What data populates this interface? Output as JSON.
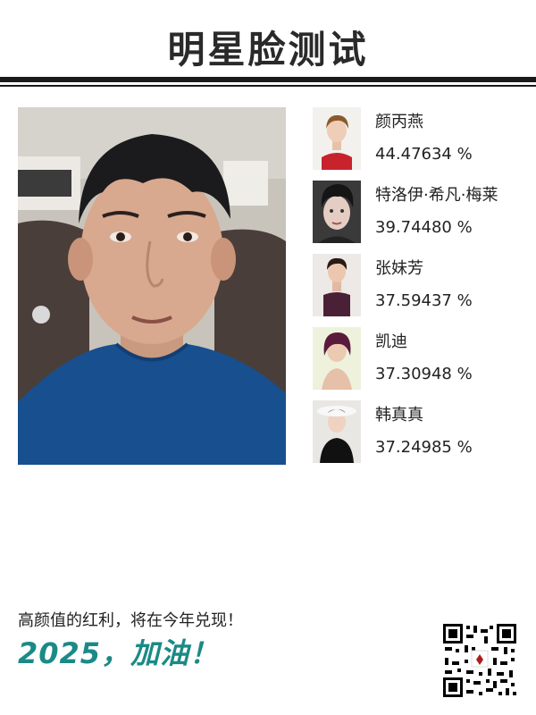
{
  "page": {
    "title": "明星脸测试"
  },
  "results": [
    {
      "name": "颜丙燕",
      "score": "44.47634 %"
    },
    {
      "name": "特洛伊·希凡·梅莱",
      "score": "39.74480 %"
    },
    {
      "name": "张妹芳",
      "score": "37.59437 %"
    },
    {
      "name": "凯迪",
      "score": "37.30948 %"
    },
    {
      "name": "韩真真",
      "score": "37.24985 %"
    }
  ],
  "footer": {
    "slogan": "高颜值的红利，将在今年兑现！",
    "cheer": "2025，加油！"
  },
  "colors": {
    "accent": "#1b8a86",
    "rule": "#1a1a1a"
  },
  "icons": {
    "qr": "qr-code-icon"
  }
}
